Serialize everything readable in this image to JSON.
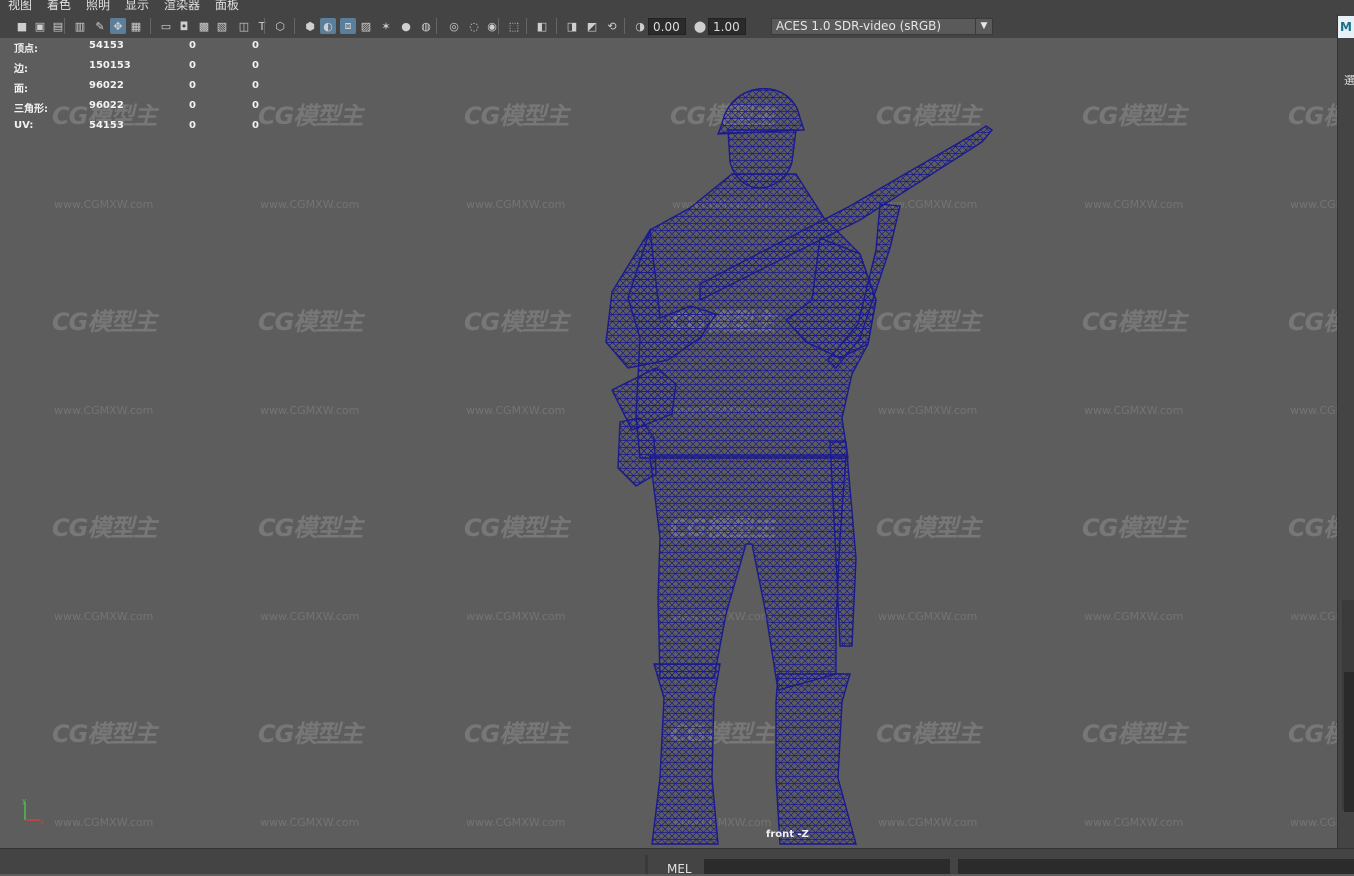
{
  "menubar": {
    "items": [
      {
        "label": "视图"
      },
      {
        "label": "着色"
      },
      {
        "label": "照明"
      },
      {
        "label": "显示"
      },
      {
        "label": "渲染器"
      },
      {
        "label": "面板"
      }
    ]
  },
  "toolbar": {
    "icons": [
      "camera-select-icon",
      "camera-attributes-icon",
      "bookmark-icon",
      "image-plane-icon",
      "grease-pencil-icon",
      "2d-pan-zoom-icon",
      "grid-icon",
      "film-gate-icon",
      "resolution-gate-icon",
      "gate-mask-icon",
      "field-chart-icon",
      "safe-action-icon",
      "safe-title-icon",
      "wireframe-icon",
      "smooth-shade-icon",
      "default-material-icon",
      "wireframe-on-shaded-icon",
      "textured-icon",
      "use-all-lights-icon",
      "shadows-icon",
      "screen-space-ao-icon",
      "motion-blur-icon",
      "anti-aliasing-icon",
      "depth-of-field-icon",
      "isolate-select-icon",
      "xray-icon",
      "xray-active-icon",
      "xray-joints-icon",
      "exposure-icon",
      "gamma-icon",
      "color-management-icon"
    ],
    "exposure_value": "0.00",
    "gamma_value": "1.00",
    "color_space": "ACES 1.0 SDR-video (sRGB)"
  },
  "hud": {
    "rows": [
      {
        "label": "顶点:",
        "v1": "54153",
        "v2": "0",
        "v3": "0"
      },
      {
        "label": "边:",
        "v1": "150153",
        "v2": "0",
        "v3": "0"
      },
      {
        "label": "面:",
        "v1": "96022",
        "v2": "0",
        "v3": "0"
      },
      {
        "label": "三角形:",
        "v1": "96022",
        "v2": "0",
        "v3": "0"
      },
      {
        "label": "UV:",
        "v1": "54153",
        "v2": "0",
        "v3": "0"
      }
    ]
  },
  "watermark": {
    "logo": "CG模型主",
    "url": "www.CGMXW.com"
  },
  "viewport": {
    "camera_label": "front -Z",
    "wire_color": "#1a1a8c"
  },
  "right_panel": {
    "badge": "M",
    "char": "選"
  },
  "statusbar": {
    "mel_label": "MEL"
  }
}
